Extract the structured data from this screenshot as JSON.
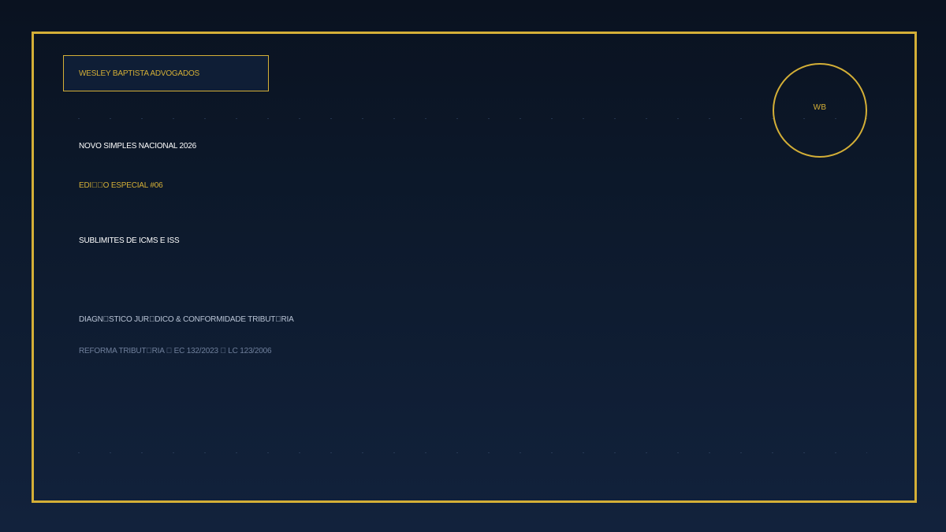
{
  "brand": {
    "firm_name": "WESLEY BAPTISTA ADVOGADOS",
    "monogram": "WB"
  },
  "content": {
    "title": "NOVO SIMPLES NACIONAL 2026",
    "edition": "EDI\u0000\u0000O ESPECIAL #06",
    "subtitle": "SUBLIMITES DE ICMS E ISS",
    "diagnostic": "DIAGN\u0000STICO JUR\u0000DICO & CONFORMIDADE TRIBUT\u0000RIA",
    "reform": "REFORMA TRIBUT\u0000RIA \u0000 EC 132/2023 \u0000 LC 123/2006"
  },
  "colors": {
    "gold": "#d4af37",
    "navy_dark": "#0a1220",
    "navy_light": "#12223c",
    "text_light": "#ffffff",
    "text_muted": "#b9c4d6",
    "text_dim": "#6f7f9b"
  }
}
